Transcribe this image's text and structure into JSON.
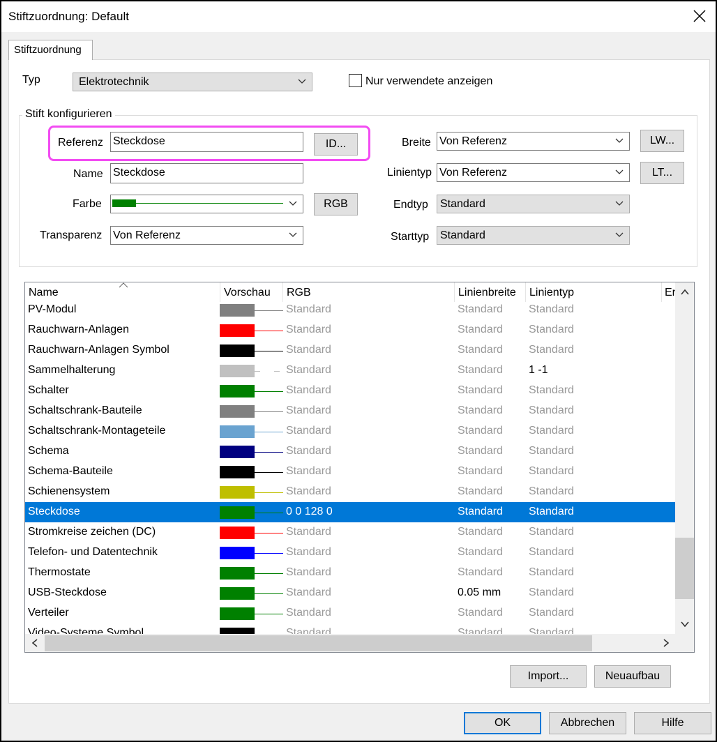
{
  "window": {
    "title": "Stiftzuordnung: Default"
  },
  "tab": {
    "label": "Stiftzuordnung"
  },
  "typ": {
    "label": "Typ",
    "value": "Elektrotechnik"
  },
  "nur_verwendete": {
    "label": "Nur verwendete anzeigen",
    "checked": false
  },
  "group": {
    "title": "Stift konfigurieren",
    "referenz": {
      "label": "Referenz",
      "value": "Steckdose",
      "button": "ID..."
    },
    "name": {
      "label": "Name",
      "value": "Steckdose"
    },
    "farbe": {
      "label": "Farbe",
      "color": "#008000",
      "button": "RGB"
    },
    "transparenz": {
      "label": "Transparenz",
      "value": "Von Referenz"
    },
    "breite": {
      "label": "Breite",
      "value": "Von Referenz",
      "button": "LW..."
    },
    "linientyp": {
      "label": "Linientyp",
      "value": "Von Referenz",
      "button": "LT..."
    },
    "endtyp": {
      "label": "Endtyp",
      "value": "Standard"
    },
    "starttyp": {
      "label": "Starttyp",
      "value": "Standard"
    }
  },
  "list": {
    "columns": [
      "Name",
      "Vorschau",
      "RGB",
      "Linienbreite",
      "Linientyp",
      "Er"
    ],
    "rows": [
      {
        "name": "PV-Modul",
        "color": "#808080",
        "rgb": "Standard",
        "width": "Standard",
        "linetype": "Standard"
      },
      {
        "name": "Rauchwarn-Anlagen",
        "color": "#ff0000",
        "rgb": "Standard",
        "width": "Standard",
        "linetype": "Standard"
      },
      {
        "name": "Rauchwarn-Anlagen Symbol",
        "color": "#000000",
        "rgb": "Standard",
        "width": "Standard",
        "linetype": "Standard"
      },
      {
        "name": "Sammelhalterung",
        "color": "#c0c0c0",
        "rgb": "Standard",
        "width": "Standard",
        "linetype": "1 -1",
        "dashed": true
      },
      {
        "name": "Schalter",
        "color": "#008000",
        "rgb": "Standard",
        "width": "Standard",
        "linetype": "Standard"
      },
      {
        "name": "Schaltschrank-Bauteile",
        "color": "#808080",
        "rgb": "Standard",
        "width": "Standard",
        "linetype": "Standard"
      },
      {
        "name": "Schaltschrank-Montageteile",
        "color": "#6aa3d0",
        "rgb": "Standard",
        "width": "Standard",
        "linetype": "Standard"
      },
      {
        "name": "Schema",
        "color": "#000080",
        "rgb": "Standard",
        "width": "Standard",
        "linetype": "Standard"
      },
      {
        "name": "Schema-Bauteile",
        "color": "#000000",
        "rgb": "Standard",
        "width": "Standard",
        "linetype": "Standard"
      },
      {
        "name": "Schienensystem",
        "color": "#bfbf00",
        "rgb": "Standard",
        "width": "Standard",
        "linetype": "Standard"
      },
      {
        "name": "Steckdose",
        "color": "#008000",
        "rgb": "0 0 128 0",
        "width": "Standard",
        "linetype": "Standard",
        "selected": true
      },
      {
        "name": "Stromkreise zeichen (DC)",
        "color": "#ff0000",
        "rgb": "Standard",
        "width": "Standard",
        "linetype": "Standard"
      },
      {
        "name": "Telefon- und Datentechnik",
        "color": "#0000ff",
        "rgb": "Standard",
        "width": "Standard",
        "linetype": "Standard"
      },
      {
        "name": "Thermostate",
        "color": "#008000",
        "rgb": "Standard",
        "width": "Standard",
        "linetype": "Standard"
      },
      {
        "name": "USB-Steckdose",
        "color": "#008000",
        "rgb": "Standard",
        "width": "0.05 mm",
        "linetype": "Standard"
      },
      {
        "name": "Verteiler",
        "color": "#008000",
        "rgb": "Standard",
        "width": "Standard",
        "linetype": "Standard"
      },
      {
        "name": "Video-Systeme Symbol",
        "color": "#000000",
        "rgb": "Standard",
        "width": "Standard",
        "linetype": "Standard"
      }
    ]
  },
  "buttons": {
    "import": "Import...",
    "neuaufbau": "Neuaufbau",
    "ok": "OK",
    "abbrechen": "Abbrechen",
    "hilfe": "Hilfe"
  }
}
